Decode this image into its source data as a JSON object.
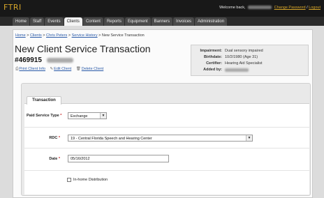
{
  "app": {
    "brand": "FTRI"
  },
  "header": {
    "welcome_prefix": "Welcome back,",
    "change_password": "Change Password",
    "separator": "/",
    "logout": "Logout"
  },
  "nav": {
    "tabs": [
      "Home",
      "Staff",
      "Events",
      "Clients",
      "Content",
      "Reports",
      "Equipment",
      "Banners",
      "Invoices",
      "Administration"
    ],
    "active": "Clients"
  },
  "breadcrumb": {
    "items": [
      "Home",
      "Clients",
      "Chris Peters",
      "Service History"
    ],
    "current": "New Service Transaction",
    "separator": ">"
  },
  "page": {
    "title": "New Client Service Transaction",
    "client_number": "#469915"
  },
  "actions": {
    "print": "Print Client Info",
    "edit": "Edit Client",
    "delete": "Delete Client"
  },
  "client_info": {
    "impairment_label": "Impairment:",
    "impairment_value": "Dual sensory impaired",
    "birthdate_label": "Birthdate:",
    "birthdate_value": "10/2/1980 (Age 31)",
    "certifier_label": "Certifier:",
    "certifier_value": "Hearing Aid Specialist",
    "added_by_label": "Added by:"
  },
  "form": {
    "section_title": "Transaction",
    "paid_service_type_label": "Paid Service Type",
    "paid_service_type_value": "Exchange",
    "rdc_label": "RDC",
    "rdc_value": "19 - Central Florida Speech and Hearing Center",
    "date_label": "Date",
    "date_value": "05/16/2012",
    "in_home_label": "In-home Distribution",
    "required_mark": "*"
  }
}
